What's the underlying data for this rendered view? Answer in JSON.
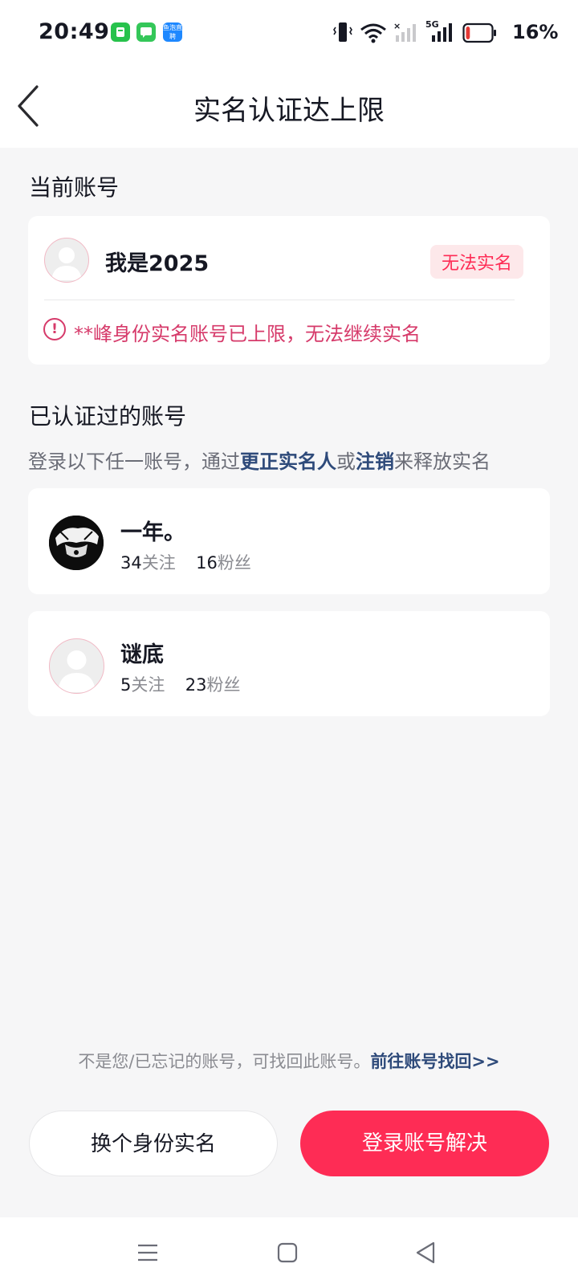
{
  "status_bar": {
    "time": "20:49",
    "battery_percent": "16%",
    "app_icon3_text": "鱼泡直聘",
    "network": "5G",
    "battery_level": 0.16
  },
  "header": {
    "title": "实名认证达上限",
    "back_icon": "chevron-left-icon"
  },
  "current_account": {
    "section_title": "当前账号",
    "name": "我是2025",
    "badge": "无法实名",
    "warning": "**峰身份实名账号已上限，无法继续实名"
  },
  "verified_accounts": {
    "section_title": "已认证过的账号",
    "desc_prefix": "登录以下任一账号，通过",
    "desc_link1": "更正实名人",
    "desc_mid": "或",
    "desc_link2": "注销",
    "desc_suffix": "来释放实名",
    "items": [
      {
        "name": "一年。",
        "following": "34",
        "following_label": "关注",
        "followers": "16",
        "followers_label": "粉丝"
      },
      {
        "name": "谜底",
        "following": "5",
        "following_label": "关注",
        "followers": "23",
        "followers_label": "粉丝"
      }
    ]
  },
  "footer": {
    "tip_text": "不是您/已忘记的账号，可找回此账号。",
    "tip_link": "前往账号找回>>",
    "btn_switch": "换个身份实名",
    "btn_login": "登录账号解决"
  },
  "colors": {
    "primary": "#fe2c55",
    "link": "#2e4a7a",
    "warning": "#d63a6a",
    "background": "#f6f6f7"
  }
}
